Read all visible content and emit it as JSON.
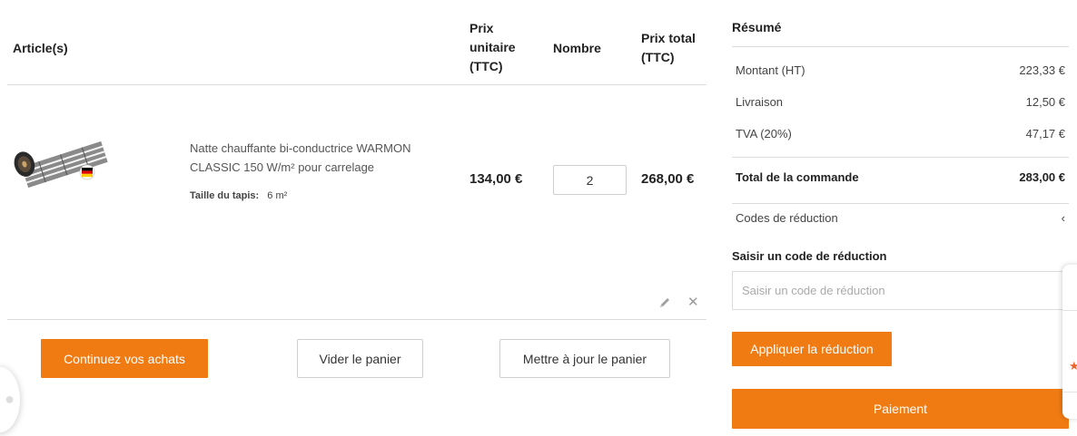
{
  "table": {
    "headers": {
      "article": "Article(s)",
      "unit_price": "Prix unitaire (TTC)",
      "quantity": "Nombre",
      "total_price": "Prix total (TTC)"
    }
  },
  "item": {
    "name": "Natte chauffante bi-conductrice WARMON CLASSIC 150 W/m² pour carrelage",
    "option_label": "Taille du tapis:",
    "option_value": "6 m²",
    "unit_price": "134,00 €",
    "quantity": "2",
    "total": "268,00 €",
    "image_icon": "heating-mat-roll-with-german-flag"
  },
  "actions": {
    "continue": "Continuez vos achats",
    "clear": "Vider le panier",
    "update": "Mettre à jour le panier"
  },
  "summary": {
    "title": "Résumé",
    "rows": [
      {
        "label": "Montant (HT)",
        "value": "223,33 €"
      },
      {
        "label": "Livraison",
        "value": "12,50 €"
      },
      {
        "label": "TVA (20%)",
        "value": "47,17 €"
      }
    ],
    "total_label": "Total de la commande",
    "total_value": "283,00 €",
    "discount_toggle": "Codes de réduction",
    "discount_chevron": "‹",
    "discount_label": "Saisir un code de réduction",
    "discount_placeholder": "Saisir un code de réduction",
    "apply": "Appliquer la réduction",
    "pay": "Paiement"
  },
  "colors": {
    "accent": "#f07b12",
    "border": "#dcdcdc",
    "star": "#e8652c"
  }
}
